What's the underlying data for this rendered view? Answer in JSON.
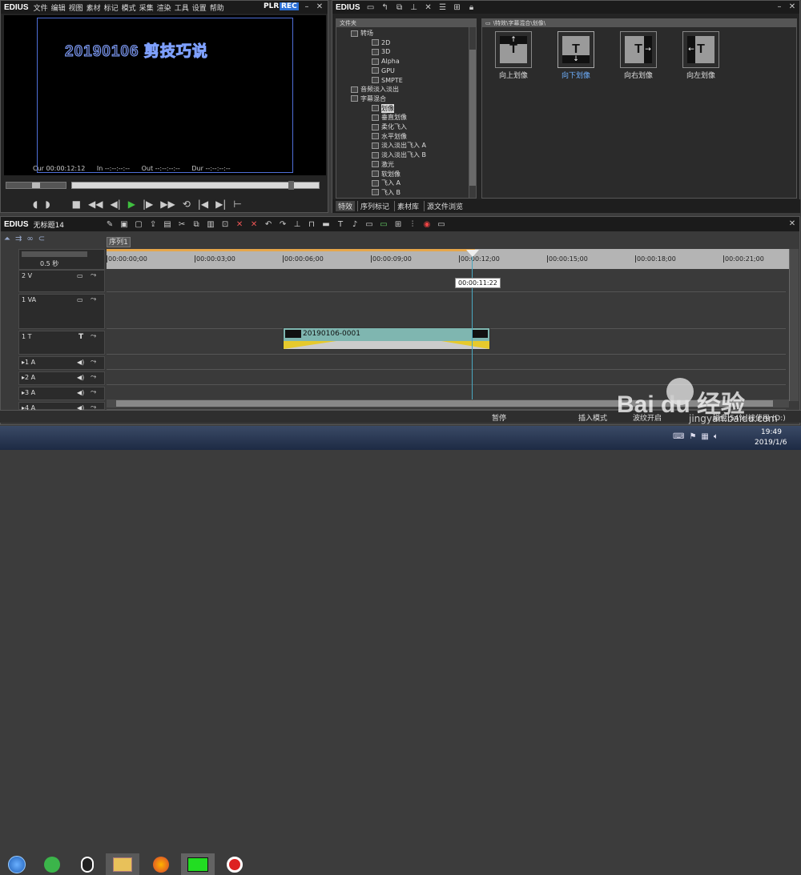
{
  "player": {
    "logo": "EDIUS",
    "menu": [
      "文件",
      "编辑",
      "视图",
      "素材",
      "标记",
      "模式",
      "采集",
      "渲染",
      "工具",
      "设置",
      "帮助"
    ],
    "plr": "PLR",
    "rec": "REC",
    "screen_text": "20190106 剪技巧说",
    "cur_label": "Cur",
    "cur_value": "00:00:12:12",
    "in_label": "In",
    "in_value": "--:--:--:--",
    "out_label": "Out",
    "out_value": "--:--:--:--",
    "dur_label": "Dur",
    "dur_value": "--:--:--:--"
  },
  "library": {
    "logo": "EDIUS",
    "folder_header": "文件夹",
    "path": "\\特效\\字幕混合\\划像\\",
    "tree": [
      {
        "label": "转场",
        "level": 1
      },
      {
        "label": "2D",
        "level": 2
      },
      {
        "label": "3D",
        "level": 2
      },
      {
        "label": "Alpha",
        "level": 2
      },
      {
        "label": "GPU",
        "level": 2
      },
      {
        "label": "SMPTE",
        "level": 2
      },
      {
        "label": "音频淡入淡出",
        "level": 1
      },
      {
        "label": "字幕混合",
        "level": 1
      },
      {
        "label": "划像",
        "level": 2
      },
      {
        "label": "垂直划像",
        "level": 2
      },
      {
        "label": "柔化飞入",
        "level": 2
      },
      {
        "label": "水平划像",
        "level": 2
      },
      {
        "label": "淡入淡出飞入 A",
        "level": 2
      },
      {
        "label": "淡入淡出飞入 B",
        "level": 2
      },
      {
        "label": "激光",
        "level": 2
      },
      {
        "label": "软划像",
        "level": 2
      },
      {
        "label": "飞入 A",
        "level": 2
      },
      {
        "label": "飞入 B",
        "level": 2
      }
    ],
    "tabs": [
      "特效",
      "序列标记",
      "素材库",
      "源文件浏览"
    ],
    "effects": [
      {
        "label": "向上划像",
        "arrow": "↑"
      },
      {
        "label": "向下划像",
        "arrow": "↓"
      },
      {
        "label": "向右划像",
        "arrow": "→"
      },
      {
        "label": "向左划像",
        "arrow": "←"
      }
    ]
  },
  "timeline": {
    "logo": "EDIUS",
    "project": "无标题14",
    "sequence_tab": "序列1",
    "zoom": "0.5 秒",
    "ruler": [
      "00:00:00;00",
      "00:00:03;00",
      "00:00:06;00",
      "00:00:09;00",
      "00:00:12;00",
      "00:00:15;00",
      "00:00:18;00",
      "00:00:21;00"
    ],
    "tooltip": "00:00:11:22",
    "tracks": [
      {
        "name": "2 V",
        "type": "V"
      },
      {
        "name": "1 VA",
        "type": "VA"
      },
      {
        "name": "1 T",
        "type": "T",
        "marker": "T"
      },
      {
        "name": "▸1 A",
        "type": "A"
      },
      {
        "name": "▸2 A",
        "type": "A"
      },
      {
        "name": "▸3 A",
        "type": "A"
      },
      {
        "name": "▸4 A",
        "type": "A"
      }
    ],
    "clip_name": "20190106-0001"
  },
  "status": {
    "pause": "暂停",
    "insert_mode": "插入模式",
    "ripple": "波纹开启",
    "disk": "磁盘:54% 被使用 (D:)"
  },
  "taskbar": {
    "time": "19:49",
    "date": "2019/1/6"
  },
  "watermark": {
    "brand": "Bai du 经验",
    "url": "jingyan.baidu.com"
  }
}
